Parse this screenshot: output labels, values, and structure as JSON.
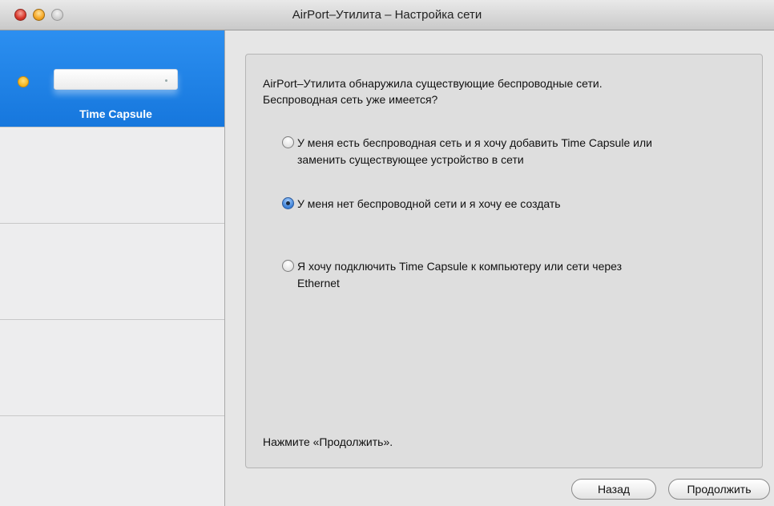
{
  "window": {
    "title": "AirPort–Утилита – Настройка сети"
  },
  "sidebar": {
    "device": {
      "name": "Time Capsule",
      "status_color": "#f2b31c"
    },
    "selected_color": "#1677dd"
  },
  "content": {
    "intro_line1": "AirPort–Утилита обнаружила существующие беспроводные сети.",
    "intro_line2": "Беспроводная сеть уже имеется?",
    "options": [
      {
        "line1": "У меня есть беспроводная сеть и я хочу добавить Time Capsule или",
        "line2": "заменить существующее устройство в сети",
        "selected": false
      },
      {
        "line1": "У меня нет беспроводной сети и я хочу ее создать",
        "line2": "",
        "selected": true
      },
      {
        "line1": "Я хочу подключить Time Capsule к компьютеру или сети через",
        "line2": "Ethernet",
        "selected": false
      }
    ],
    "footer": "Нажмите «Продолжить»."
  },
  "buttons": {
    "back": "Назад",
    "continue": "Продолжить"
  }
}
